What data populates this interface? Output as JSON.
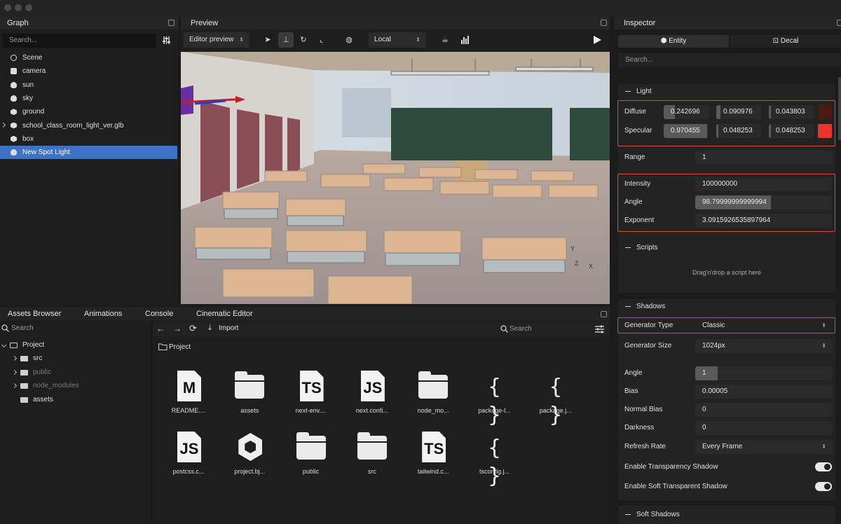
{
  "graph": {
    "title": "Graph",
    "search_placeholder": "Search...",
    "items": [
      {
        "label": "Scene",
        "icon": "scene-icon"
      },
      {
        "label": "camera",
        "icon": "camera-icon"
      },
      {
        "label": "sun",
        "icon": "bulb-icon"
      },
      {
        "label": "sky",
        "icon": "bulb-icon"
      },
      {
        "label": "ground",
        "icon": "cube-icon"
      },
      {
        "label": "school_class_room_light_ver.glb",
        "icon": "cube-icon"
      },
      {
        "label": "box",
        "icon": "cube-icon"
      },
      {
        "label": "New Spot Light",
        "icon": "bulb-icon",
        "selected": true
      }
    ]
  },
  "preview": {
    "title": "Preview",
    "mode_select": "Editor preview",
    "space_select": "Local",
    "gizmo_labels": {
      "y": "Y",
      "z": "Z",
      "x": "X"
    }
  },
  "bottom_tabs": [
    "Assets Browser",
    "Animations",
    "Console",
    "Cinematic Editor"
  ],
  "assets": {
    "search_placeholder": "Search",
    "import_label": "Import",
    "right_search_placeholder": "Search",
    "breadcrumb": "Project",
    "tree": [
      {
        "label": "Project",
        "dim": false
      },
      {
        "label": "src",
        "dim": false
      },
      {
        "label": "public",
        "dim": true
      },
      {
        "label": "node_modules",
        "dim": true
      },
      {
        "label": "assets",
        "dim": false
      }
    ],
    "files": [
      {
        "name": "README....",
        "type": "md"
      },
      {
        "name": "assets",
        "type": "folder"
      },
      {
        "name": "next-env....",
        "type": "ts"
      },
      {
        "name": "next.confi...",
        "type": "js"
      },
      {
        "name": "node_mo...",
        "type": "folder"
      },
      {
        "name": "package-l...",
        "type": "json"
      },
      {
        "name": "package.j...",
        "type": "json"
      },
      {
        "name": "postcss.c...",
        "type": "js"
      },
      {
        "name": "project.bj...",
        "type": "hex"
      },
      {
        "name": "public",
        "type": "folder"
      },
      {
        "name": "src",
        "type": "folder"
      },
      {
        "name": "tailwind.c...",
        "type": "ts"
      },
      {
        "name": "tsconfig.j...",
        "type": "json"
      }
    ]
  },
  "inspector": {
    "title": "Inspector",
    "tab_entity": "Entity",
    "tab_decal": "Decal",
    "search_placeholder": "Search...",
    "light": {
      "header": "Light",
      "diffuse_label": "Diffuse",
      "diffuse": [
        "0.242696",
        "0.090976",
        "0.043803"
      ],
      "diffuse_color": "#4a1a10",
      "specular_label": "Specular",
      "specular": [
        "0.970455",
        "0.048253",
        "0.048253"
      ],
      "specular_color": "#e8362c",
      "range_label": "Range",
      "range": "1",
      "intensity_label": "Intensity",
      "intensity": "100000000",
      "angle_label": "Angle",
      "angle": "98.79999999999994",
      "exponent_label": "Exponent",
      "exponent": "3.0915926535897964"
    },
    "scripts": {
      "header": "Scripts",
      "drop_text": "Drag'n'drop a script here"
    },
    "shadows": {
      "header": "Shadows",
      "generator_type_label": "Generator Type",
      "generator_type": "Classic",
      "generator_size_label": "Generator Size",
      "generator_size": "1024px",
      "angle_label": "Angle",
      "angle": "1",
      "bias_label": "Bias",
      "bias": "0.00005",
      "normal_bias_label": "Normal Bias",
      "normal_bias": "0",
      "darkness_label": "Darkness",
      "darkness": "0",
      "refresh_rate_label": "Refresh Rate",
      "refresh_rate": "Every Frame",
      "transparency_label": "Enable Transparency Shadow",
      "soft_transparent_label": "Enable Soft Transparent Shadow"
    },
    "soft_shadows": {
      "header": "Soft Shadows"
    }
  }
}
